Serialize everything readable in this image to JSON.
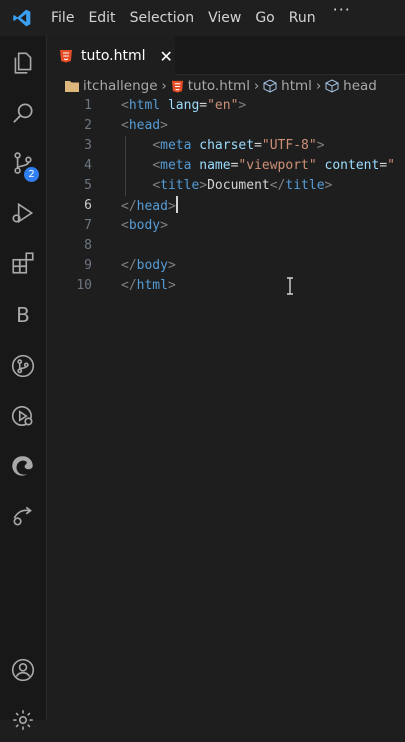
{
  "menu": {
    "items": [
      "File",
      "Edit",
      "Selection",
      "View",
      "Go",
      "Run"
    ],
    "more": "···"
  },
  "activity": {
    "scm_badge": "2",
    "letter_item": "B"
  },
  "tab": {
    "label": "tuto.html",
    "close": "✕"
  },
  "breadcrumb": {
    "folder": "itchallenge",
    "file": "tuto.html",
    "el1": "html",
    "el2": "head"
  },
  "editor": {
    "line_numbers": [
      "1",
      "2",
      "3",
      "4",
      "5",
      "6",
      "7",
      "8",
      "9",
      "10"
    ],
    "active_line": 6,
    "lines": [
      [
        [
          "punc",
          "<"
        ],
        [
          "tag",
          "html"
        ],
        [
          "txt",
          " "
        ],
        [
          "attr",
          "lang"
        ],
        [
          "txt",
          "="
        ],
        [
          "str",
          "\"en\""
        ],
        [
          "punc",
          ">"
        ]
      ],
      [
        [
          "punc",
          "<"
        ],
        [
          "tag",
          "head"
        ],
        [
          "punc",
          ">"
        ]
      ],
      [
        [
          "txt",
          "    "
        ],
        [
          "punc",
          "<"
        ],
        [
          "tag",
          "meta"
        ],
        [
          "txt",
          " "
        ],
        [
          "attr",
          "charset"
        ],
        [
          "txt",
          "="
        ],
        [
          "str",
          "\"UTF-8\""
        ],
        [
          "punc",
          ">"
        ]
      ],
      [
        [
          "txt",
          "    "
        ],
        [
          "punc",
          "<"
        ],
        [
          "tag",
          "meta"
        ],
        [
          "txt",
          " "
        ],
        [
          "attr",
          "name"
        ],
        [
          "txt",
          "="
        ],
        [
          "str",
          "\"viewport\""
        ],
        [
          "txt",
          " "
        ],
        [
          "attr",
          "content"
        ],
        [
          "txt",
          "="
        ],
        [
          "str",
          "\""
        ]
      ],
      [
        [
          "txt",
          "    "
        ],
        [
          "punc",
          "<"
        ],
        [
          "tag",
          "title"
        ],
        [
          "punc",
          ">"
        ],
        [
          "txt",
          "Document"
        ],
        [
          "punc",
          "</"
        ],
        [
          "tag",
          "title"
        ],
        [
          "punc",
          ">"
        ]
      ],
      [
        [
          "punc",
          "</"
        ],
        [
          "tag",
          "head"
        ],
        [
          "punc",
          ">"
        ]
      ],
      [
        [
          "punc",
          "<"
        ],
        [
          "tag",
          "body"
        ],
        [
          "punc",
          ">"
        ]
      ],
      [],
      [
        [
          "punc",
          "</"
        ],
        [
          "tag",
          "body"
        ],
        [
          "punc",
          ">"
        ]
      ],
      [
        [
          "punc",
          "</"
        ],
        [
          "tag",
          "html"
        ],
        [
          "punc",
          ">"
        ]
      ]
    ]
  },
  "colors": {
    "accent": "#2f7ff0",
    "html_icon": "#e44d26",
    "tag": "#569cd6",
    "attr": "#9cdcfe",
    "string": "#ce9178"
  }
}
